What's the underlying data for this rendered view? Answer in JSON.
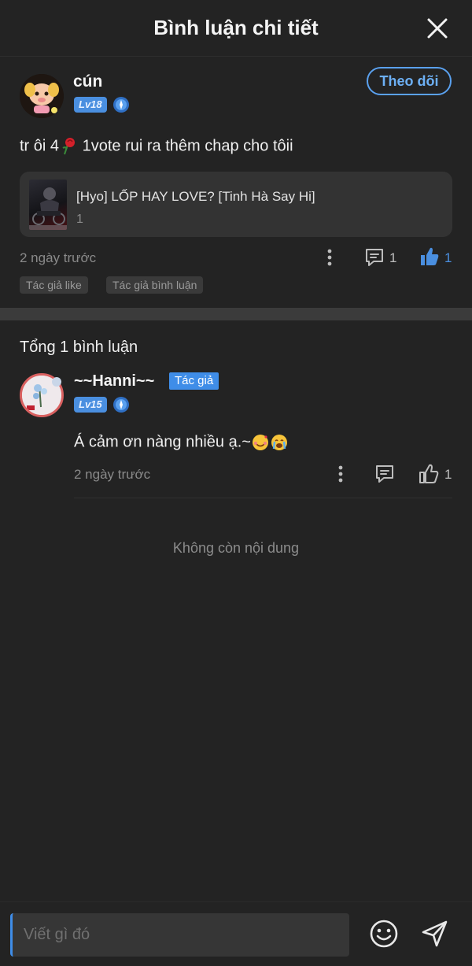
{
  "header": {
    "title": "Bình luận chi tiết"
  },
  "main_comment": {
    "username": "cún",
    "level": "Lv18",
    "follow_label": "Theo dõi",
    "text_before_emoji": "tr ôi 4",
    "text_after_emoji": " 1vote rui ra thêm chap cho tôii",
    "linked_story": {
      "title": "[Hyo] LỐP HAY LOVE? [Tinh Hà Say Hi]",
      "subtitle": "1"
    },
    "time": "2 ngày trước",
    "reply_count": "1",
    "like_count": "1",
    "tags": [
      "Tác giả like",
      "Tác giả bình luận"
    ]
  },
  "replies": {
    "total_label": "Tổng 1 bình luận",
    "items": [
      {
        "username": "~~Hanni~~",
        "author_tag": "Tác giả",
        "level": "Lv15",
        "text": "Á cảm ơn nàng nhiều ạ.~",
        "time": "2 ngày trước",
        "like_count": "1"
      }
    ]
  },
  "end_text": "Không còn nội dung",
  "composer": {
    "placeholder": "Viết gì đó"
  },
  "colors": {
    "accent": "#3f8de8",
    "background": "#232323",
    "card": "#333333"
  },
  "icons": [
    "close-icon",
    "medal-icon",
    "more-vertical-icon",
    "comment-icon",
    "thumbs-up-icon",
    "smiley-icon",
    "send-icon"
  ]
}
